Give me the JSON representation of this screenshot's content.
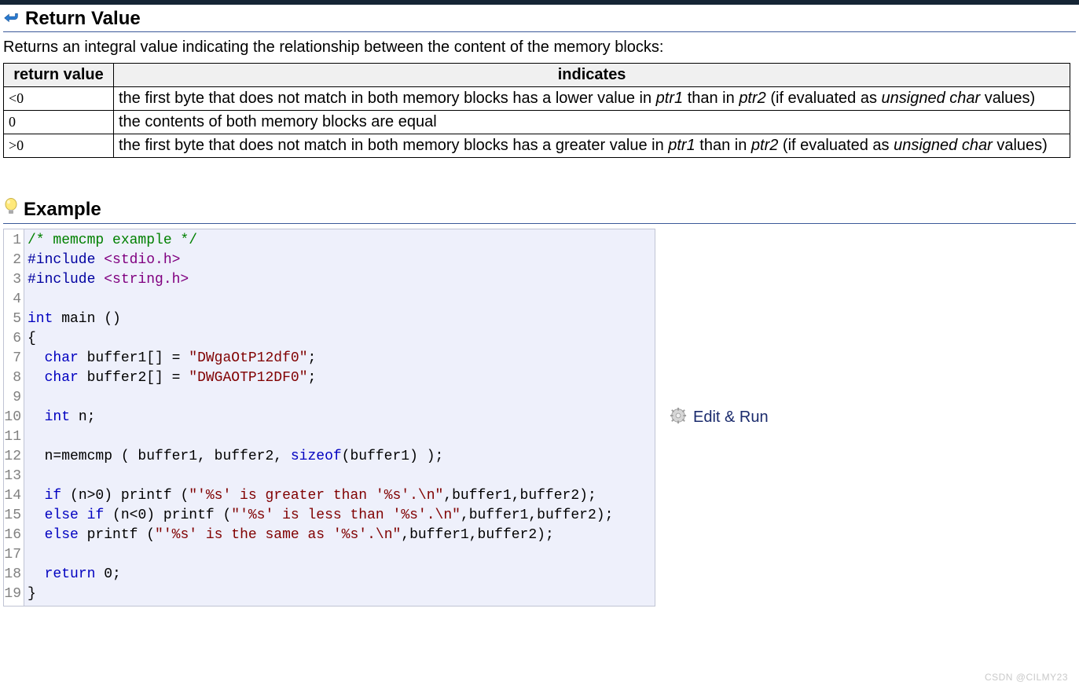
{
  "return_value": {
    "heading": "Return Value",
    "description": "Returns an integral value indicating the relationship between the content of the memory blocks:",
    "table": {
      "headers": [
        "return value",
        "indicates"
      ],
      "rows": [
        {
          "value": "<0",
          "desc_parts": {
            "p1": "the first byte that does not match in both memory blocks has a lower value in ",
            "ptr1": "ptr1",
            "p2": " than in ",
            "ptr2": "ptr2",
            "p3": " (if evaluated as ",
            "uchar": "unsigned char",
            "p4": " values)"
          }
        },
        {
          "value": "0",
          "desc_plain": "the contents of both memory blocks are equal"
        },
        {
          "value": ">0",
          "desc_parts": {
            "p1": "the first byte that does not match in both memory blocks has a greater value in ",
            "ptr1": "ptr1",
            "p2": " than in ",
            "ptr2": "ptr2",
            "p3": " (if evaluated as ",
            "uchar": "unsigned char",
            "p4": " values)"
          }
        }
      ]
    }
  },
  "example": {
    "heading": "Example",
    "edit_run": "Edit & Run",
    "line_numbers": [
      "1",
      "2",
      "3",
      "4",
      "5",
      "6",
      "7",
      "8",
      "9",
      "10",
      "11",
      "12",
      "13",
      "14",
      "15",
      "16",
      "17",
      "18",
      "19"
    ],
    "code": {
      "l1_comment": "/* memcmp example */",
      "l2_pre": "#include ",
      "l2_inc": "<stdio.h>",
      "l3_pre": "#include ",
      "l3_inc": "<string.h>",
      "l5_kw": "int",
      "l5_rest": " main ()",
      "l6": "{",
      "l7_indent": "  ",
      "l7_kw": "char",
      "l7_mid": " buffer1[] = ",
      "l7_str": "\"DWgaOtP12df0\"",
      "l7_end": ";",
      "l8_indent": "  ",
      "l8_kw": "char",
      "l8_mid": " buffer2[] = ",
      "l8_str": "\"DWGAOTP12DF0\"",
      "l8_end": ";",
      "l10_indent": "  ",
      "l10_kw": "int",
      "l10_rest": " n;",
      "l12_a": "  n=memcmp ( buffer1, buffer2, ",
      "l12_fn": "sizeof",
      "l12_b": "(buffer1) );",
      "l14_kw": "if",
      "l14_a": "  ",
      "l14_b": " (n>0) printf (",
      "l14_str": "\"'%s' is greater than '%s'.\\n\"",
      "l14_c": ",buffer1,buffer2);",
      "l15_kw1": "else",
      "l15_kw2": "if",
      "l15_a": "  ",
      "l15_sp": " ",
      "l15_b": " (n<0) printf (",
      "l15_str": "\"'%s' is less than '%s'.\\n\"",
      "l15_c": ",buffer1,buffer2);",
      "l16_kw": "else",
      "l16_a": "  ",
      "l16_b": " printf (",
      "l16_str": "\"'%s' is the same as '%s'.\\n\"",
      "l16_c": ",buffer1,buffer2);",
      "l18_kw": "return",
      "l18_a": "  ",
      "l18_b": " 0;",
      "l19": "}"
    }
  },
  "watermark": "CSDN @CILMY23"
}
